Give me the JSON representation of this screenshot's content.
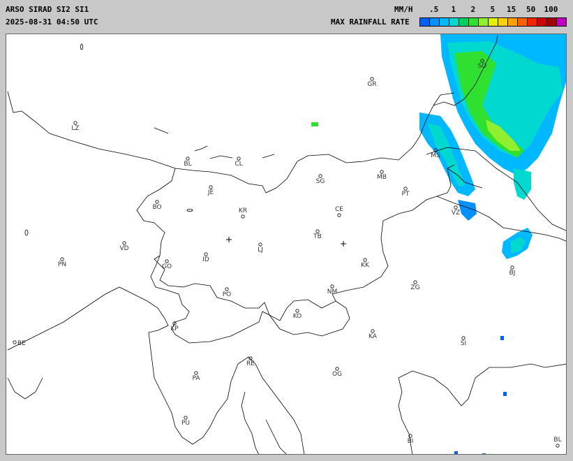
{
  "header": {
    "product_title": "ARSO SIRAD SI2 SI1",
    "timestamp": "2025-08-31 04:50 UTC",
    "unit_label": "MM/H",
    "legend_caption": "MAX RAINFALL RATE"
  },
  "legend": {
    "ticks": [
      ".5",
      "1",
      "2",
      "5",
      "15",
      "50",
      "100"
    ],
    "colors": [
      "#0060ff",
      "#0090ff",
      "#00b8ff",
      "#00d8d0",
      "#00d060",
      "#30e030",
      "#90f030",
      "#e0f000",
      "#ffd000",
      "#ffa000",
      "#ff6000",
      "#ff2000",
      "#d00000",
      "#a00000",
      "#c000c0"
    ]
  },
  "map": {
    "stations": [
      {
        "code": "GR"
      },
      {
        "code": "SO"
      },
      {
        "code": "LZ"
      },
      {
        "code": "BL"
      },
      {
        "code": "CL"
      },
      {
        "code": "MS"
      },
      {
        "code": "MB"
      },
      {
        "code": "SG"
      },
      {
        "code": "JE"
      },
      {
        "code": "PT"
      },
      {
        "code": "BO"
      },
      {
        "code": "KR"
      },
      {
        "code": "CE"
      },
      {
        "code": "VZ"
      },
      {
        "code": "TB"
      },
      {
        "code": "VD"
      },
      {
        "code": "LJ"
      },
      {
        "code": "PN"
      },
      {
        "code": "GO"
      },
      {
        "code": "ID"
      },
      {
        "code": "KK"
      },
      {
        "code": "BJ"
      },
      {
        "code": "PO"
      },
      {
        "code": "NM"
      },
      {
        "code": "ZG"
      },
      {
        "code": "KO"
      },
      {
        "code": "KP"
      },
      {
        "code": "KA"
      },
      {
        "code": "SI"
      },
      {
        "code": "BE"
      },
      {
        "code": "RE"
      },
      {
        "code": "PA"
      },
      {
        "code": "OG"
      },
      {
        "code": "PU"
      },
      {
        "code": "BI"
      },
      {
        "code": "BL"
      }
    ]
  }
}
